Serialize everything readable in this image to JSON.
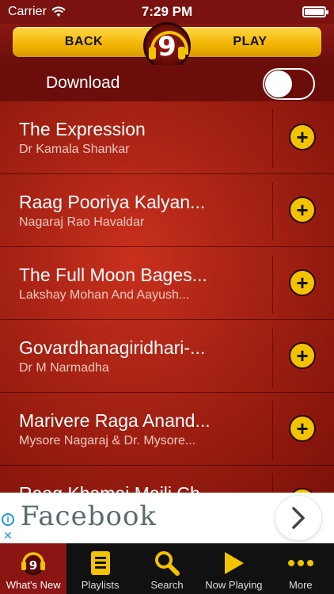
{
  "status_bar": {
    "carrier": "Carrier",
    "time": "7:29 PM"
  },
  "header": {
    "back_label": "BACK",
    "play_label": "PLAY",
    "logo_text": "9"
  },
  "download": {
    "label": "Download",
    "enabled": false
  },
  "tracks": [
    {
      "title": "The Expression",
      "artist": "Dr Kamala Shankar"
    },
    {
      "title": "Raag Pooriya Kalyan...",
      "artist": "Nagaraj Rao Havaldar"
    },
    {
      "title": "The Full Moon Bages...",
      "artist": "Lakshay Mohan And Aayush..."
    },
    {
      "title": "Govardhanagiridhari-...",
      "artist": "Dr M Narmadha"
    },
    {
      "title": "Marivere Raga Anand...",
      "artist": "Mysore Nagaraj & Dr. Mysore..."
    },
    {
      "title": "Raag Khamaj Maili Ch...",
      "artist": ""
    }
  ],
  "ad": {
    "brand": "Facebook"
  },
  "tabs": [
    {
      "label": "What's New",
      "icon": "headphones-logo-icon"
    },
    {
      "label": "Playlists",
      "icon": "list-icon"
    },
    {
      "label": "Search",
      "icon": "search-icon"
    },
    {
      "label": "Now Playing",
      "icon": "play-icon"
    },
    {
      "label": "More",
      "icon": "more-dots-icon"
    }
  ],
  "colors": {
    "accent": "#f2c300",
    "active_tab": "#8a1512",
    "background": "#a82314"
  }
}
